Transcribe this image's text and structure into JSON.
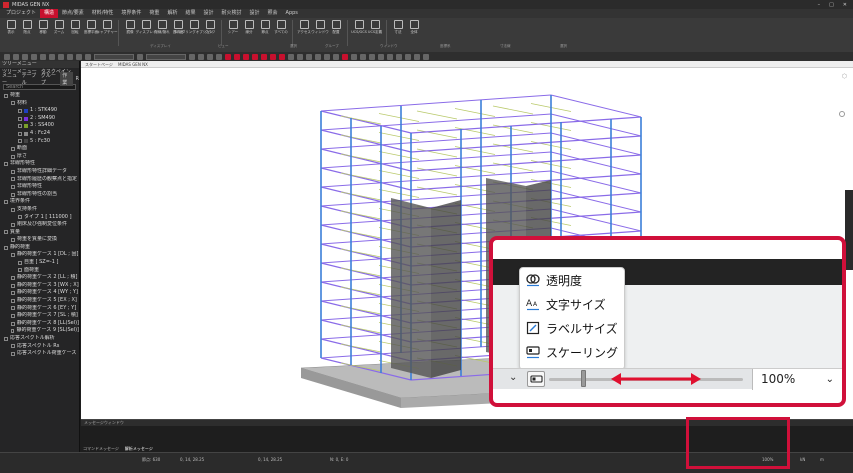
{
  "app": {
    "title": "MIDAS GEN NX"
  },
  "menu": [
    "プロジェクト",
    "構造",
    "節点/要素",
    "材料/特性",
    "境界条件",
    "荷重",
    "解析",
    "結果",
    "設計",
    "耐火検討",
    "設計",
    "照会",
    "Apps"
  ],
  "menu_active_index": 1,
  "ribbon": {
    "buttons": [
      "表示",
      "陰点",
      "移動",
      "ズーム",
      "回転",
      "座標平面",
      "キャプチャー",
      "鏡像",
      "ディスプレイ",
      "隠線/隠れ",
      "透明度",
      "レンダリングオプション",
      "グラフ",
      "シアー",
      "線分",
      "節点",
      "すべての",
      "アクセス",
      "ウィンドウ",
      "配置",
      "UCS/GCS",
      "UCS定義",
      "寸法",
      "全体"
    ],
    "groups": [
      "ディスプレイ",
      "ビュー",
      "選択",
      "グループ",
      "ウィンドウ",
      "座標系",
      "寸法線",
      "選択"
    ]
  },
  "left_panel": {
    "header": "ツリーメニュー",
    "tabs": [
      "ツリーメニュー",
      "タスクペイン"
    ],
    "subtabs": [
      "メニュー",
      "テーブル",
      "グループ",
      "作業",
      "R"
    ],
    "search_placeholder": "Search",
    "tree": [
      {
        "label": "荷重",
        "level": 0
      },
      {
        "label": "材料",
        "level": 1
      },
      {
        "label": "1 : STK490",
        "level": 2,
        "color": "#1f3fbf"
      },
      {
        "label": "2 : SM490",
        "level": 2,
        "color": "#7b2fe0"
      },
      {
        "label": "3 : SS400",
        "level": 2,
        "color": "#7a9f2a"
      },
      {
        "label": "4 : Fc24",
        "level": 2,
        "color": "#888888"
      },
      {
        "label": "5 : Fc30",
        "level": 2,
        "color": "#444444"
      },
      {
        "label": "断面",
        "level": 1
      },
      {
        "label": "厚さ",
        "level": 1
      },
      {
        "label": "非線形特性",
        "level": 0
      },
      {
        "label": "非線形特性詳細データ",
        "level": 1
      },
      {
        "label": "非線形履歴の観察点と指定",
        "level": 1
      },
      {
        "label": "非線形特性",
        "level": 1
      },
      {
        "label": "非線形特性の割当",
        "level": 1
      },
      {
        "label": "境界条件",
        "level": 0
      },
      {
        "label": "支持条件",
        "level": 1
      },
      {
        "label": "タイプ 1 [ 111000 ]",
        "level": 2
      },
      {
        "label": "剛床及び強制変位条件",
        "level": 1
      },
      {
        "label": "質量",
        "level": 0
      },
      {
        "label": "荷重を質量に変換",
        "level": 1
      },
      {
        "label": "静的荷重",
        "level": 0
      },
      {
        "label": "静的荷重ケース 1 [DL ; 固]",
        "level": 1
      },
      {
        "label": "自重 [ SZ=-1 ]",
        "level": 2
      },
      {
        "label": "面荷重",
        "level": 2
      },
      {
        "label": "静的荷重ケース 2 [LL ; 積]",
        "level": 1
      },
      {
        "label": "静的荷重ケース 3 [WX ; X]",
        "level": 1
      },
      {
        "label": "静的荷重ケース 4 [WY ; Y]",
        "level": 1
      },
      {
        "label": "静的荷重ケース 5 [EX ; X]",
        "level": 1
      },
      {
        "label": "静的荷重ケース 6 [EY ; Y]",
        "level": 1
      },
      {
        "label": "静的荷重ケース 7 [SL ; 積]",
        "level": 1
      },
      {
        "label": "静的荷重ケース 8 [LL(Sel)]",
        "level": 1
      },
      {
        "label": "静的荷重ケース 9 [SL(Sel)]",
        "level": 1
      },
      {
        "label": "応答スペクトル解析",
        "level": 0
      },
      {
        "label": "応答スペクトル Rs",
        "level": 1
      },
      {
        "label": "応答スペクトル荷重ケース",
        "level": 1
      }
    ]
  },
  "canvas": {
    "tab_label": "スタートページ",
    "model_tab": "MIDAS GEN NX"
  },
  "bottom_panel": {
    "header": "メッセージウィンドウ",
    "tabs": [
      "コマンドメッセージ",
      "解析メッセージ"
    ]
  },
  "status": {
    "nodes": "節点: 630",
    "coord1": "0, 14, 28.25",
    "coord2": "0, 14, 28.25",
    "n": "N: 0, E: 0",
    "zoom": "100%",
    "unit": "kN",
    "length": "m"
  },
  "zoom_popup": {
    "items": [
      {
        "label": "透明度",
        "icon": "transparency-icon"
      },
      {
        "label": "文字サイズ",
        "icon": "text-size-icon"
      },
      {
        "label": "ラベルサイズ",
        "icon": "label-size-icon"
      },
      {
        "label": "スケーリング",
        "icon": "scaling-icon"
      }
    ],
    "slider_value_percent": "100%",
    "accent": "#e0102f"
  }
}
